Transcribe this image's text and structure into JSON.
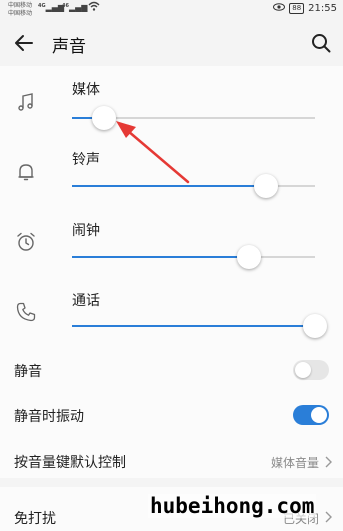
{
  "status_bar": {
    "carrier_1": "中国移动",
    "carrier_2": "中国移动",
    "signal_1": "4G",
    "signal_2": "46",
    "battery": "88",
    "time": "21:55"
  },
  "header": {
    "title": "声音"
  },
  "volumes": [
    {
      "label": "媒体",
      "icon": "music-note-icon",
      "level": 0.13
    },
    {
      "label": "铃声",
      "icon": "bell-icon",
      "level": 0.8
    },
    {
      "label": "闹钟",
      "icon": "alarm-clock-icon",
      "level": 0.73
    },
    {
      "label": "通话",
      "icon": "phone-icon",
      "level": 1.0
    }
  ],
  "settings": {
    "mute_label": "静音",
    "mute_on": false,
    "vibrate_label": "静音时振动",
    "vibrate_on": true,
    "volume_key_label": "按音量键默认控制",
    "volume_key_value": "媒体音量",
    "dnd_label": "免打扰",
    "dnd_value": "已关闭"
  },
  "watermark": "hubeihong.com",
  "colors": {
    "accent": "#2a7ed8",
    "annotation_arrow": "#e53935"
  }
}
